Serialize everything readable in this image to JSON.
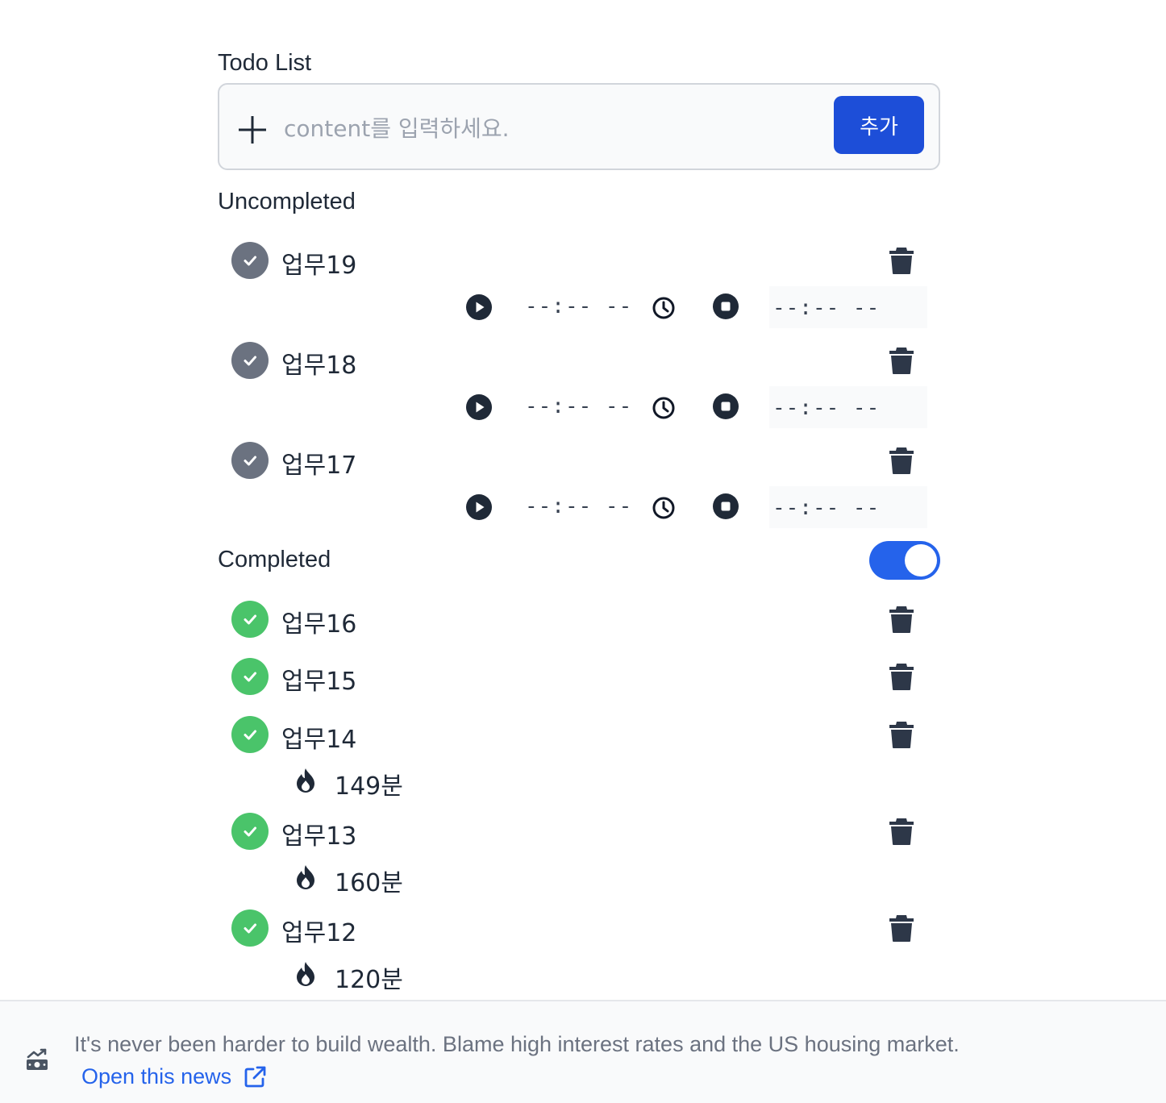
{
  "app": {
    "title": "Todo List",
    "input_placeholder": "content를 입력하세요.",
    "add_label": "추가"
  },
  "sections": {
    "uncompleted": "Uncompleted",
    "completed": "Completed",
    "completed_toggle_on": true
  },
  "uncompleted": [
    {
      "title": "업무19",
      "start_time": "--:-- --",
      "end_time": "--:-- --"
    },
    {
      "title": "업무18",
      "start_time": "--:-- --",
      "end_time": "--:-- --"
    },
    {
      "title": "업무17",
      "start_time": "--:-- --",
      "end_time": "--:-- --"
    }
  ],
  "completed": [
    {
      "title": "업무16"
    },
    {
      "title": "업무15"
    },
    {
      "title": "업무14",
      "duration": "149분"
    },
    {
      "title": "업무13",
      "duration": "160분"
    },
    {
      "title": "업무12",
      "duration": "120분"
    }
  ],
  "footer": {
    "headline": "It's never been harder to build wealth. Blame high interest rates and the US housing market.",
    "link_label": "Open this news"
  },
  "colors": {
    "accent": "#1d4ed8",
    "toggle": "#2563eb",
    "check_pending": "#6b7280",
    "check_done": "#4ac46a"
  }
}
